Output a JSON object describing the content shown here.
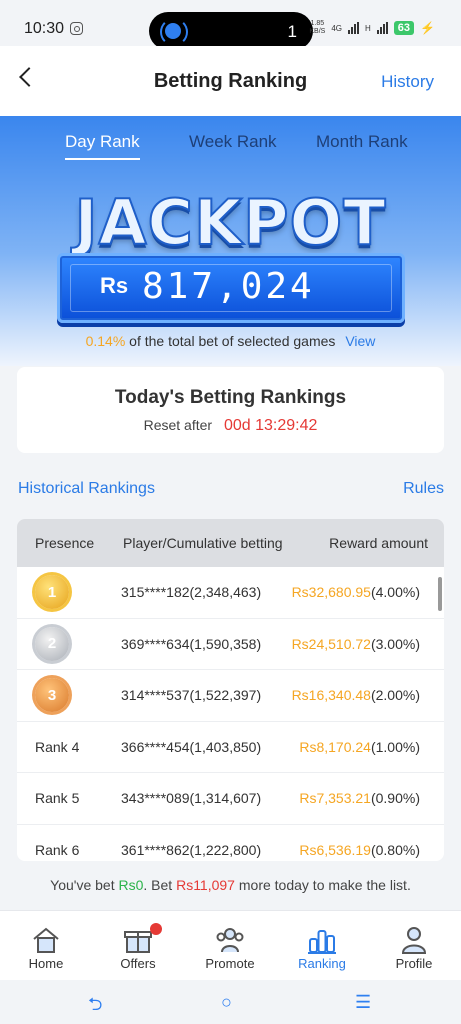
{
  "status": {
    "time": "10:30",
    "pill_count": "1",
    "net_speed_top": "1.85",
    "net_speed_bottom": "KB/S",
    "net_4g": "4G",
    "net_h": "H",
    "battery": "63"
  },
  "header": {
    "title": "Betting Ranking",
    "history_link": "History"
  },
  "tabs": {
    "day": "Day Rank",
    "week": "Week Rank",
    "month": "Month Rank"
  },
  "jackpot": {
    "title": "JACKPOT",
    "currency": "Rs",
    "amount": "817,024",
    "percent": "0.14%",
    "description": "of the total bet of selected games",
    "view_link": "View"
  },
  "today": {
    "title": "Today's Betting Rankings",
    "reset_label": "Reset after",
    "countdown": "00d 13:29:42"
  },
  "links": {
    "historical": "Historical Rankings",
    "rules": "Rules"
  },
  "table": {
    "headers": {
      "presence": "Presence",
      "player": "Player/Cumulative betting",
      "reward": "Reward amount"
    },
    "rows": [
      {
        "rank": "1",
        "rank_label": "",
        "player": "315****182(2,348,463)",
        "amount": "Rs32,680.95",
        "percent": "(4.00%)"
      },
      {
        "rank": "2",
        "rank_label": "",
        "player": "369****634(1,590,358)",
        "amount": "Rs24,510.72",
        "percent": "(3.00%)"
      },
      {
        "rank": "3",
        "rank_label": "",
        "player": "314****537(1,522,397)",
        "amount": "Rs16,340.48",
        "percent": "(2.00%)"
      },
      {
        "rank": "4",
        "rank_label": "Rank 4",
        "player": "366****454(1,403,850)",
        "amount": "Rs8,170.24",
        "percent": "(1.00%)"
      },
      {
        "rank": "5",
        "rank_label": "Rank 5",
        "player": "343****089(1,314,607)",
        "amount": "Rs7,353.21",
        "percent": "(0.90%)"
      },
      {
        "rank": "6",
        "rank_label": "Rank 6",
        "player": "361****862(1,222,800)",
        "amount": "Rs6,536.19",
        "percent": "(0.80%)"
      }
    ]
  },
  "note": {
    "prefix": "You've bet ",
    "bet_amount": "Rs0",
    "middle": ". Bet ",
    "needed_amount": "Rs11,097",
    "suffix": " more today to make the list."
  },
  "nav": {
    "home": "Home",
    "offers": "Offers",
    "promote": "Promote",
    "ranking": "Ranking",
    "profile": "Profile"
  },
  "colors": {
    "accent": "#2b7be6",
    "gold": "#f5a623",
    "red": "#e53935",
    "green": "#2bb34a"
  }
}
